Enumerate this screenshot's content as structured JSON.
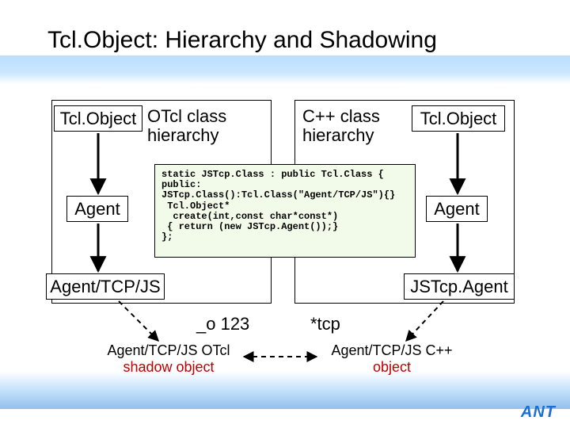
{
  "title": "Tcl.Object: Hierarchy and Shadowing",
  "left": {
    "heading": "OTcl class\nhierarchy",
    "top_node": "Tcl.Object",
    "mid_node": "Agent",
    "bottom_node": "Agent/TCP/JS"
  },
  "right": {
    "heading": "C++ class\nhierarchy",
    "top_node": "Tcl.Object",
    "mid_node": "Agent",
    "bottom_node": "JSTcp.Agent"
  },
  "code": "static JSTcp.Class : public Tcl.Class {\npublic:\nJSTcp.Class():Tcl.Class(\"Agent/TCP/JS\"){}\n Tcl.Object*\n  create(int,const char*const*)\n { return (new JSTcp.Agent());}\n};",
  "pointers": {
    "left": "_o 123",
    "right": "*tcp"
  },
  "shadow": {
    "left_line1": "Agent/TCP/JS OTcl",
    "left_line2": "shadow object",
    "right_line1": "Agent/TCP/JS C++",
    "right_line2": "object"
  },
  "footer": "ANT"
}
